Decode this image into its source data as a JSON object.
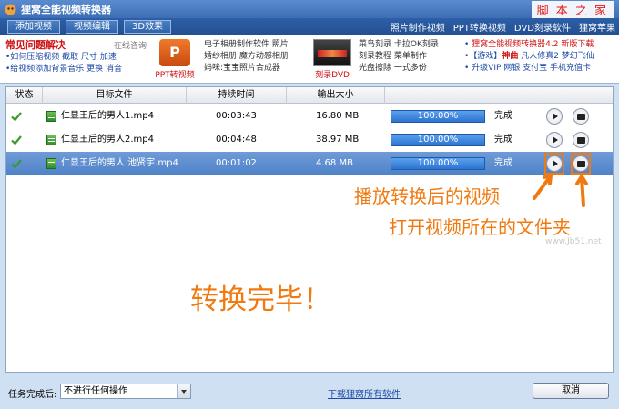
{
  "window": {
    "title": "狸窝全能视频转换器",
    "watermark": "脚 本 之 家"
  },
  "menubar": {
    "buttons": [
      "添加视频",
      "视频编辑",
      "3D效果"
    ],
    "links": [
      "照片制作视频",
      "PPT转换视频",
      "DVD刻录软件",
      "狸窝苹果"
    ]
  },
  "banner": {
    "faq_title": "常见问题解决",
    "faq_online": "在线咨询",
    "faq_lines": [
      "•如何压缩视频 截取 尺寸 加速",
      "•给视频添加背景音乐 更换 消音"
    ],
    "ppt_logo_text": "P",
    "ppt_label": "PPT转视频",
    "col1": [
      "电子相册制作软件 照片",
      "婚纱相册 魔方动感相册",
      "妈咪:宝宝照片合成器"
    ],
    "dvd_label": "刻录DVD",
    "col2": [
      "菜鸟刻录 卡拉OK刻录",
      "刻录教程 菜单制作",
      "光盘擦除 一式多份"
    ],
    "col3_line1_prefix": "• ",
    "col3_line1": "狸窝全能视频转换器4.2 新版下载",
    "col3_line2_a": "•【游戏】",
    "col3_line2_b": "神曲",
    "col3_line2_c": " 凡人修真2 梦幻飞仙",
    "col3_line3": "• 升级VIP 网银 支付宝 手机充值卡"
  },
  "table": {
    "headers": [
      "状态",
      "目标文件",
      "持续时间",
      "输出大小"
    ],
    "rows": [
      {
        "file": "仁显王后的男人1.mp4",
        "duration": "00:03:43",
        "size": "16.80 MB",
        "progress": "100.00%",
        "progress_value": 100,
        "status": "完成"
      },
      {
        "file": "仁显王后的男人2.mp4",
        "duration": "00:04:48",
        "size": "38.97 MB",
        "progress": "100.00%",
        "progress_value": 100,
        "status": "完成"
      },
      {
        "file": "仁显王后的男人 池贤宇.mp4",
        "duration": "00:01:02",
        "size": "4.68 MB",
        "progress": "100.00%",
        "progress_value": 100,
        "status": "完成"
      }
    ]
  },
  "annotations": {
    "play": "播放转换后的视频",
    "folder": "打开视频所在的文件夹",
    "done": "转换完毕！",
    "url": "www.Jb51.net"
  },
  "bottom": {
    "label": "任务完成后:",
    "select_value": "不进行任何操作",
    "download_link": "下载狸窝所有软件",
    "cancel": "取消"
  },
  "colors": {
    "accent": "#f07a10",
    "selected_row": "#5b8cd0",
    "progress": "#3b84dd"
  }
}
